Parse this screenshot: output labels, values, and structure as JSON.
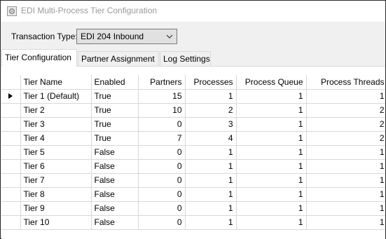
{
  "window": {
    "title": "EDI Multi-Process Tier Configuration"
  },
  "transaction_type": {
    "label": "Transaction Type:",
    "value": "EDI 204 Inbound"
  },
  "tabs": [
    {
      "label": "Tier Configuration",
      "active": true
    },
    {
      "label": "Partner Assignment",
      "active": false
    },
    {
      "label": "Log Settings",
      "active": false
    }
  ],
  "grid": {
    "columns": [
      "Tier Name",
      "Enabled",
      "Partners",
      "Processes",
      "Process Queue",
      "Process Threads"
    ],
    "current_row_index": 0,
    "rows": [
      {
        "tier_name": "Tier 1 (Default)",
        "enabled": "True",
        "partners": "15",
        "processes": "1",
        "process_queue": "1",
        "process_threads": "1"
      },
      {
        "tier_name": "Tier 2",
        "enabled": "True",
        "partners": "10",
        "processes": "2",
        "process_queue": "1",
        "process_threads": "2"
      },
      {
        "tier_name": "Tier 3",
        "enabled": "True",
        "partners": "0",
        "processes": "3",
        "process_queue": "1",
        "process_threads": "2"
      },
      {
        "tier_name": "Tier 4",
        "enabled": "True",
        "partners": "7",
        "processes": "4",
        "process_queue": "1",
        "process_threads": "2"
      },
      {
        "tier_name": "Tier 5",
        "enabled": "False",
        "partners": "0",
        "processes": "1",
        "process_queue": "1",
        "process_threads": "1"
      },
      {
        "tier_name": "Tier 6",
        "enabled": "False",
        "partners": "0",
        "processes": "1",
        "process_queue": "1",
        "process_threads": "1"
      },
      {
        "tier_name": "Tier 7",
        "enabled": "False",
        "partners": "0",
        "processes": "1",
        "process_queue": "1",
        "process_threads": "1"
      },
      {
        "tier_name": "Tier 8",
        "enabled": "False",
        "partners": "0",
        "processes": "1",
        "process_queue": "1",
        "process_threads": "1"
      },
      {
        "tier_name": "Tier 9",
        "enabled": "False",
        "partners": "0",
        "processes": "1",
        "process_queue": "1",
        "process_threads": "1"
      },
      {
        "tier_name": "Tier 10",
        "enabled": "False",
        "partners": "0",
        "processes": "1",
        "process_queue": "1",
        "process_threads": "1"
      }
    ]
  }
}
